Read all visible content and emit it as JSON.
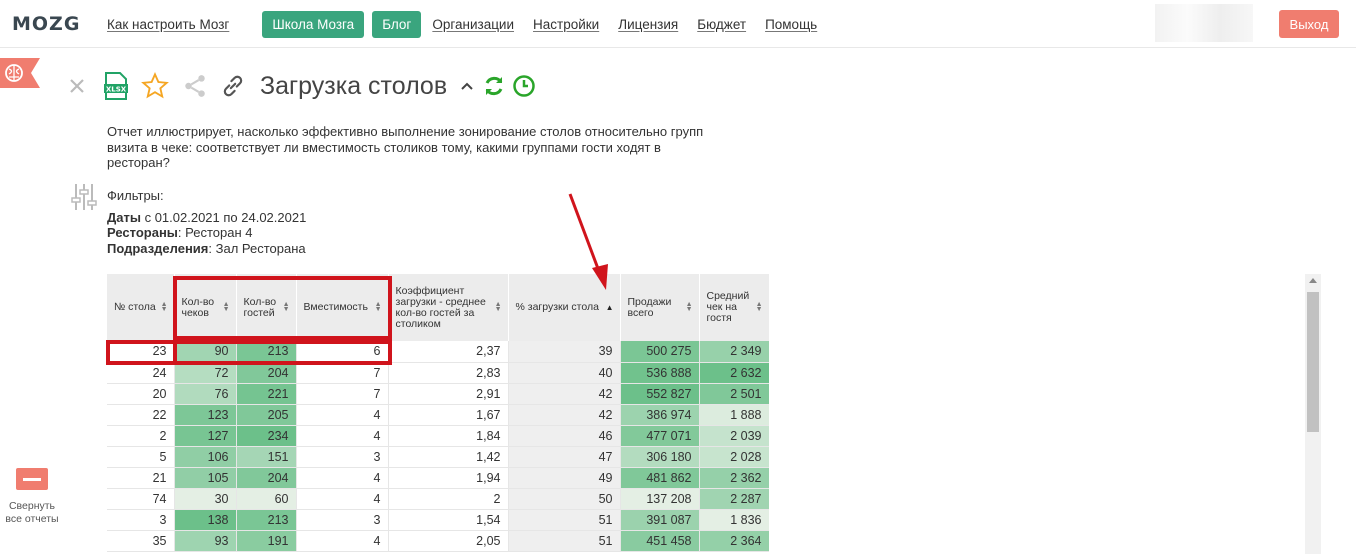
{
  "app": {
    "logo": "MOZG"
  },
  "nav": {
    "how_to": "Как настроить Мозг",
    "school": "Школа Мозга",
    "blog": "Блог",
    "orgs": "Организации",
    "settings": "Настройки",
    "license": "Лицензия",
    "budget": "Бюджет",
    "help": "Помощь",
    "logout": "Выход"
  },
  "sidebar": {
    "collapse_label": "Свернуть все отчеты"
  },
  "report": {
    "title": "Загрузка столов",
    "xlsx_label": "XLSX",
    "description": "Отчет иллюстрирует, насколько эффективно выполнение зонирование столов относительно групп визита в чеке: соответствует ли вместимость столиков тому, какими группами гости ходят в ресторан?",
    "filters_heading": "Фильтры:",
    "filters": [
      {
        "label": "Даты",
        "value": " с 01.02.2021 по 24.02.2021"
      },
      {
        "label": "Рестораны",
        "value": ": Ресторан 4"
      },
      {
        "label": "Подразделения",
        "value": ": Зал Ресторана"
      }
    ]
  },
  "table": {
    "headers": [
      "№ стола",
      "Кол-во чеков",
      "Кол-во гостей",
      "Вместимость",
      "Коэффициент загрузки - среднее кол-во гостей за столиком",
      "% загрузки стола",
      "Продажи всего",
      "Средний чек на гостя"
    ],
    "sorted_column": 5,
    "sort_direction": "ascending",
    "rows": [
      [
        "23",
        "90",
        "213",
        "6",
        "2,37",
        "39",
        "500 275",
        "2 349"
      ],
      [
        "24",
        "72",
        "204",
        "7",
        "2,83",
        "40",
        "536 888",
        "2 632"
      ],
      [
        "20",
        "76",
        "221",
        "7",
        "2,91",
        "42",
        "552 827",
        "2 501"
      ],
      [
        "22",
        "123",
        "205",
        "4",
        "1,67",
        "42",
        "386 974",
        "1 888"
      ],
      [
        "2",
        "127",
        "234",
        "4",
        "1,84",
        "46",
        "477 071",
        "2 039"
      ],
      [
        "5",
        "106",
        "151",
        "3",
        "1,42",
        "47",
        "306 180",
        "2 028"
      ],
      [
        "21",
        "105",
        "204",
        "4",
        "1,94",
        "49",
        "481 862",
        "2 362"
      ],
      [
        "74",
        "30",
        "60",
        "4",
        "2",
        "50",
        "137 208",
        "2 287"
      ],
      [
        "3",
        "138",
        "213",
        "3",
        "1,54",
        "51",
        "391 087",
        "1 836"
      ],
      [
        "35",
        "93",
        "191",
        "4",
        "2,05",
        "51",
        "451 458",
        "2 364"
      ]
    ]
  },
  "colors": {
    "accent_green": "#3aa57e",
    "logout_red": "#f07d6f",
    "annotation_red": "#d0141c",
    "heat_low": "#e4efe4",
    "heat_high": "#6cc08a"
  }
}
